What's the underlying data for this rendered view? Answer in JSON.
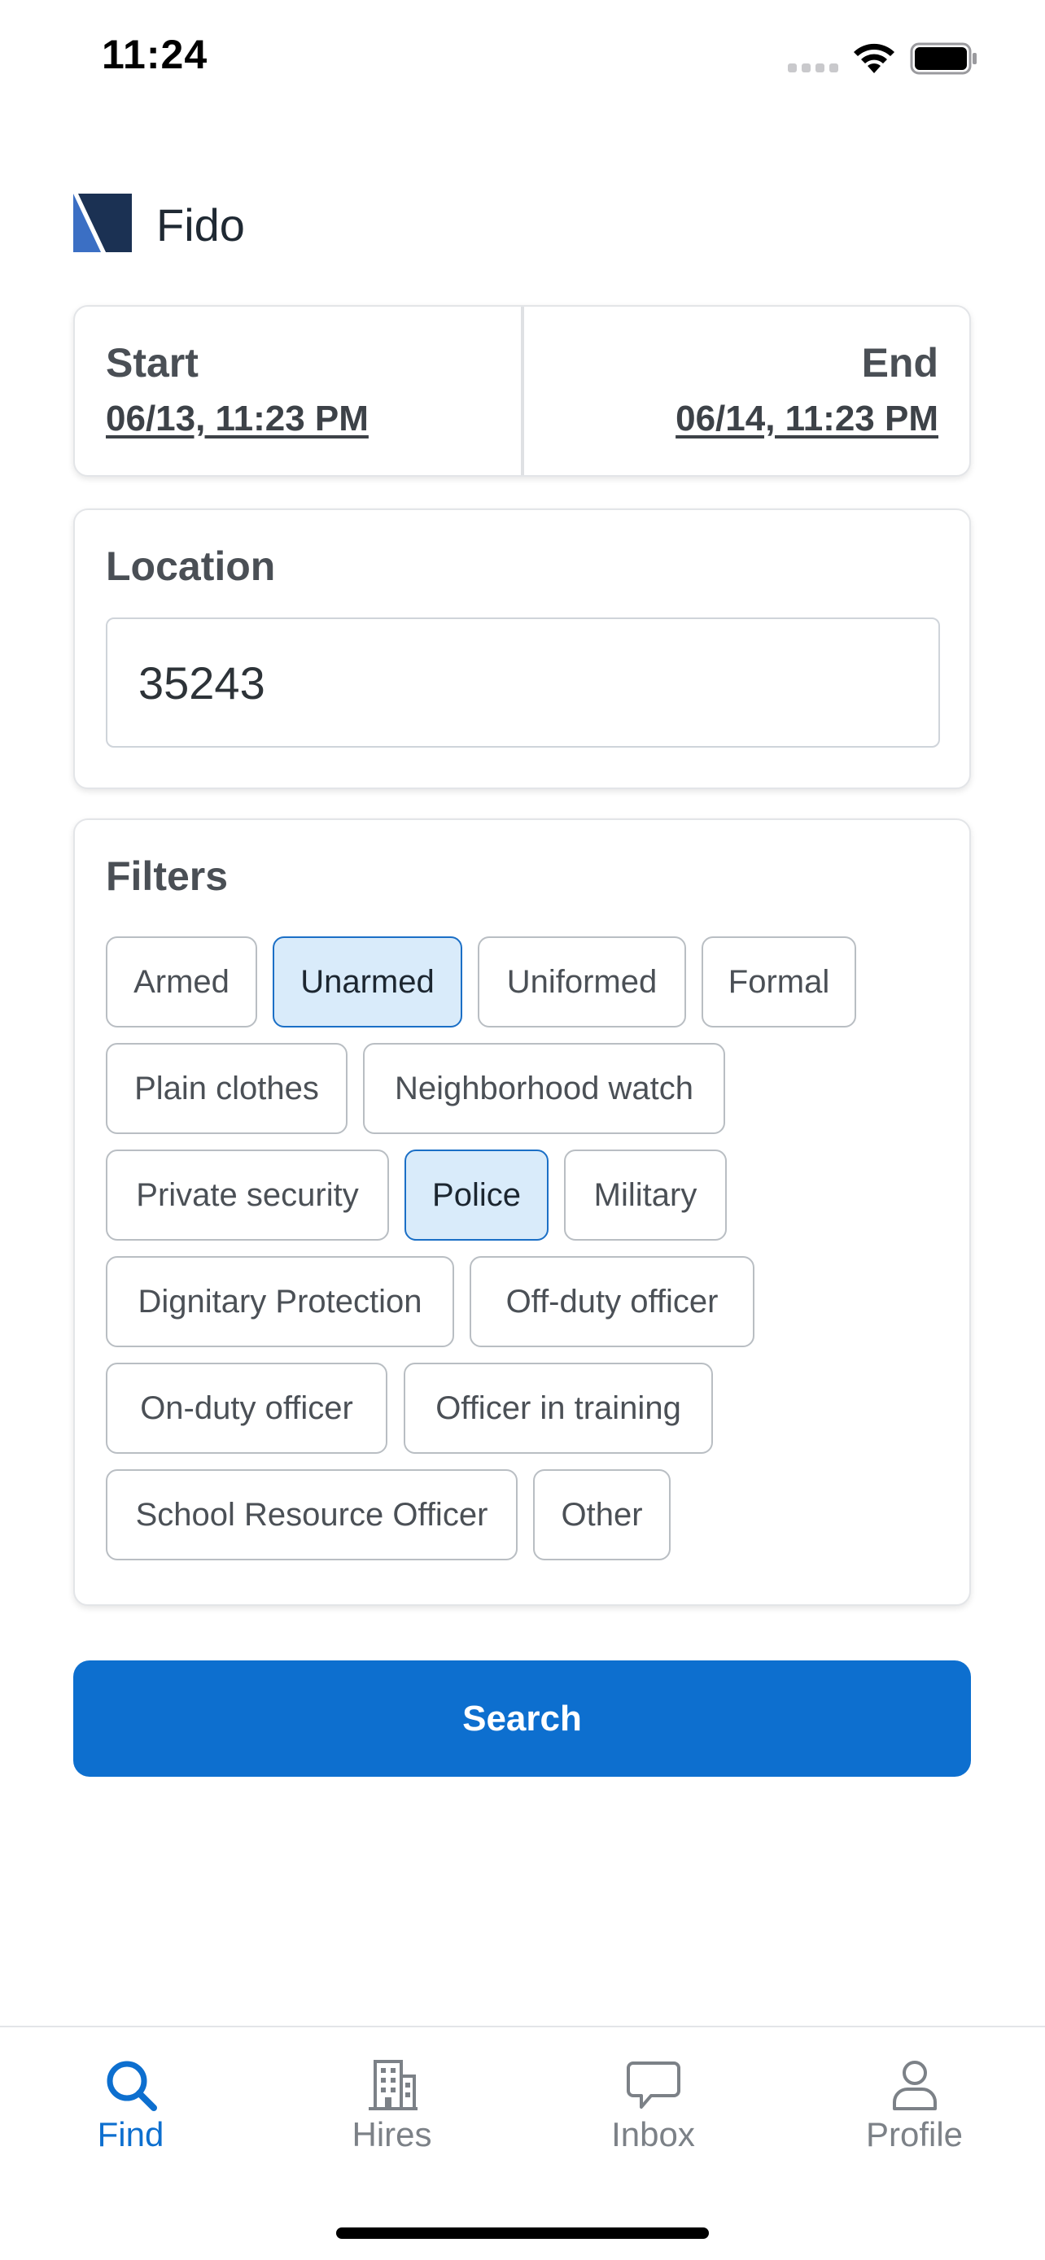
{
  "status_bar": {
    "time": "11:24"
  },
  "app": {
    "name": "Fido",
    "logo_icon": "fido-logo-icon",
    "brand_dark": "#1b3153",
    "brand_blue": "#3b6fc4"
  },
  "date_range": {
    "start_label": "Start",
    "start_value": "06/13, 11:23 PM",
    "end_label": "End",
    "end_value": "06/14, 11:23 PM"
  },
  "location": {
    "title": "Location",
    "value": "35243"
  },
  "filters": {
    "title": "Filters",
    "chips": [
      {
        "label": "Armed",
        "selected": false
      },
      {
        "label": "Unarmed",
        "selected": true
      },
      {
        "label": "Uniformed",
        "selected": false
      },
      {
        "label": "Formal",
        "selected": false
      },
      {
        "label": "Plain clothes",
        "selected": false
      },
      {
        "label": "Neighborhood watch",
        "selected": false
      },
      {
        "label": "Private security",
        "selected": false
      },
      {
        "label": "Police",
        "selected": true
      },
      {
        "label": "Military",
        "selected": false
      },
      {
        "label": "Dignitary Protection",
        "selected": false
      },
      {
        "label": "Off-duty officer",
        "selected": false
      },
      {
        "label": "On-duty officer",
        "selected": false
      },
      {
        "label": "Officer in training",
        "selected": false
      },
      {
        "label": "School Resource Officer",
        "selected": false
      },
      {
        "label": "Other",
        "selected": false
      }
    ]
  },
  "search_button": {
    "label": "Search",
    "color": "#0d6fcf"
  },
  "tab_bar": {
    "tabs": [
      {
        "label": "Find",
        "icon": "search-icon",
        "active": true
      },
      {
        "label": "Hires",
        "icon": "building-icon",
        "active": false
      },
      {
        "label": "Inbox",
        "icon": "chat-bubble-icon",
        "active": false
      },
      {
        "label": "Profile",
        "icon": "person-icon",
        "active": false
      }
    ]
  }
}
